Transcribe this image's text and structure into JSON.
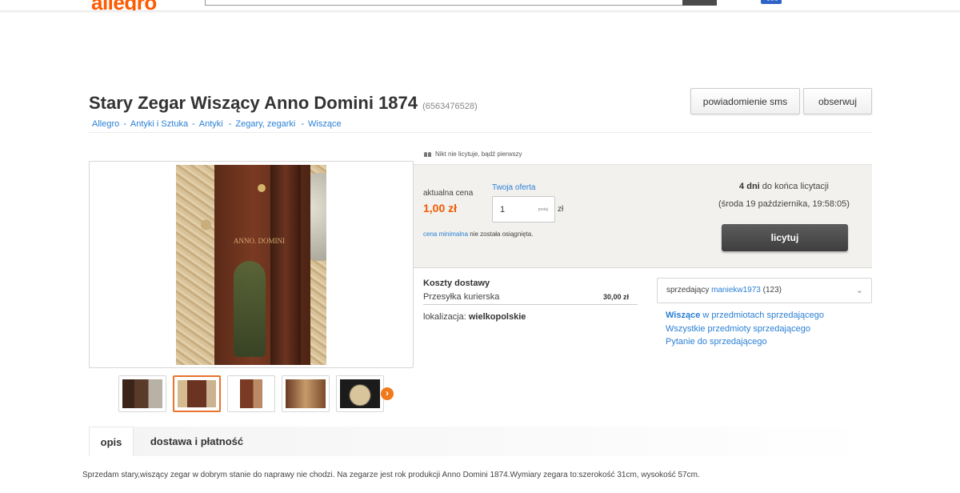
{
  "header": {
    "logo_text": "allegro"
  },
  "offer": {
    "title": "Stary Zegar Wiszący Anno Domini 1874",
    "id_text": "(6563476528)"
  },
  "actions": {
    "sms_label": "powiadomienie sms",
    "watch_label": "obserwuj"
  },
  "breadcrumb": [
    "Allegro",
    "Antyki i Sztuka",
    "Antyki",
    "Zegary, zegarki",
    "Wiszące"
  ],
  "bidding": {
    "bidders_note": "Nikt nie licytuje, bądź pierwszy",
    "current_price_label": "aktualna cena",
    "current_price": "1,00 zł",
    "your_offer_label": "Twoja oferta",
    "your_offer_value": "1",
    "your_offer_hint": "podaj",
    "currency": "zł",
    "min_price_link": "cena minimalna",
    "min_price_text": " nie została osiągnięta.",
    "time_left_bold": "4 dni",
    "time_left_text": " do końca licytacji",
    "end_date": "(środa 19 października, 19:58:05)",
    "bid_button": "licytuj"
  },
  "delivery": {
    "title": "Koszty dostawy",
    "method": "Przesyłka kurierska",
    "price": "30,00 zł",
    "location_label": "lokalizacja: ",
    "location_value": "wielkopolskie"
  },
  "seller": {
    "label": "sprzedający ",
    "name": "maniekw1973",
    "rating": " (123)",
    "links": {
      "category_bold": "Wiszące",
      "category_rest": " w przedmiotach sprzedającego",
      "all_items": "Wszystkie przedmioty sprzedającego",
      "ask": "Pytanie do sprzedającego"
    }
  },
  "image": {
    "painted_text": "ANNO. DOMINI"
  },
  "tabs": [
    "opis",
    "dostawa i płatność"
  ],
  "description": "Sprzedam stary,wiszący zegar w dobrym stanie do naprawy nie chodzi. Na zegarze jest rok produkcji Anno Domini 1874.Wymiary zegara to:szerokość 31cm, wysokość 57cm.",
  "colors": {
    "brand": "#ff5a00",
    "link": "#2a7fd4",
    "price": "#f05a00",
    "thumb_selected": "#e9732e"
  }
}
